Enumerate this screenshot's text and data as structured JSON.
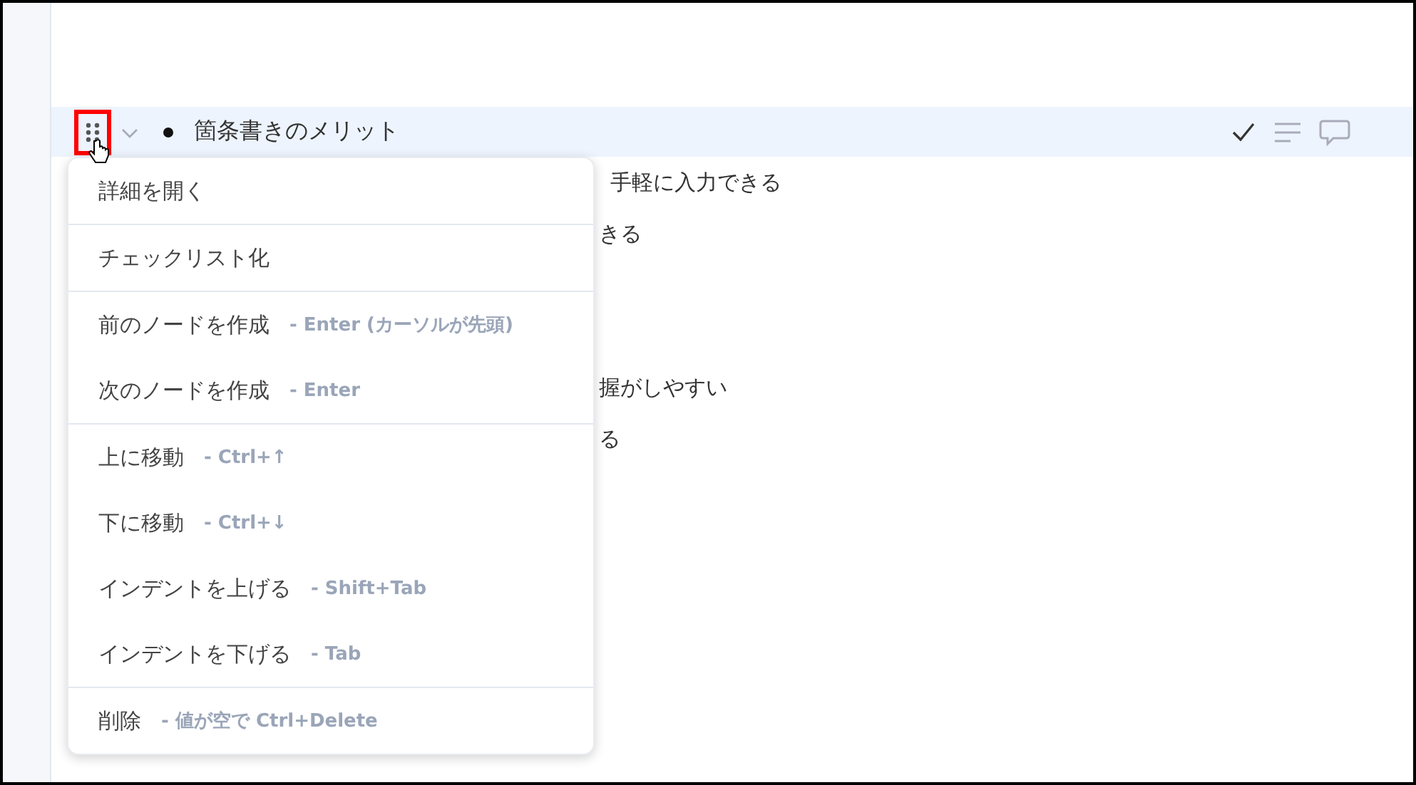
{
  "outline": {
    "node": {
      "title": "箇条書きのメリット",
      "selected": true
    },
    "lines": [
      "手軽に入力できる",
      "きる",
      "握がしやすい",
      "る"
    ]
  },
  "context_menu": {
    "sections": [
      [
        {
          "label": "詳細を開く"
        }
      ],
      [
        {
          "label": "チェックリスト化"
        }
      ],
      [
        {
          "label": "前のノードを作成",
          "shortcut": "- Enter (カーソルが先頭)"
        },
        {
          "label": "次のノードを作成",
          "shortcut": "- Enter"
        }
      ],
      [
        {
          "label": "上に移動",
          "shortcut": "- Ctrl+↑"
        },
        {
          "label": "下に移動",
          "shortcut": "- Ctrl+↓"
        },
        {
          "label": "インデントを上げる",
          "shortcut": "- Shift+Tab"
        },
        {
          "label": "インデントを下げる",
          "shortcut": "- Tab"
        }
      ],
      [
        {
          "label": "削除",
          "shortcut": "- 値が空で Ctrl+Delete"
        }
      ]
    ]
  }
}
